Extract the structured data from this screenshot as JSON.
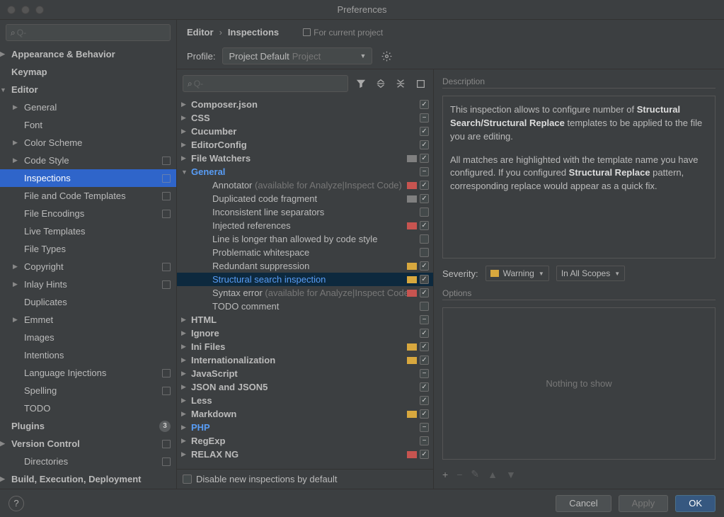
{
  "window": {
    "title": "Preferences"
  },
  "sidebar": {
    "search_placeholder": "Q-",
    "items": [
      {
        "label": "Appearance & Behavior",
        "level": 0,
        "arrow": "▶"
      },
      {
        "label": "Keymap",
        "level": 0
      },
      {
        "label": "Editor",
        "level": 0,
        "arrow": "▼"
      },
      {
        "label": "General",
        "level": 1,
        "arrow": "▶"
      },
      {
        "label": "Font",
        "level": 1
      },
      {
        "label": "Color Scheme",
        "level": 1,
        "arrow": "▶"
      },
      {
        "label": "Code Style",
        "level": 1,
        "arrow": "▶",
        "proj": true
      },
      {
        "label": "Inspections",
        "level": 1,
        "proj": true,
        "selected": true
      },
      {
        "label": "File and Code Templates",
        "level": 1,
        "proj": true
      },
      {
        "label": "File Encodings",
        "level": 1,
        "proj": true
      },
      {
        "label": "Live Templates",
        "level": 1
      },
      {
        "label": "File Types",
        "level": 1
      },
      {
        "label": "Copyright",
        "level": 1,
        "arrow": "▶",
        "proj": true
      },
      {
        "label": "Inlay Hints",
        "level": 1,
        "arrow": "▶",
        "proj": true
      },
      {
        "label": "Duplicates",
        "level": 1
      },
      {
        "label": "Emmet",
        "level": 1,
        "arrow": "▶"
      },
      {
        "label": "Images",
        "level": 1
      },
      {
        "label": "Intentions",
        "level": 1
      },
      {
        "label": "Language Injections",
        "level": 1,
        "proj": true
      },
      {
        "label": "Spelling",
        "level": 1,
        "proj": true
      },
      {
        "label": "TODO",
        "level": 1
      },
      {
        "label": "Plugins",
        "level": 0,
        "badge": "3"
      },
      {
        "label": "Version Control",
        "level": 0,
        "arrow": "▶",
        "proj": true
      },
      {
        "label": "Directories",
        "level": 1,
        "proj": true
      },
      {
        "label": "Build, Execution, Deployment",
        "level": 0,
        "arrow": "▶"
      }
    ]
  },
  "breadcrumb": {
    "a": "Editor",
    "b": "Inspections",
    "for_project": "For current project"
  },
  "profile": {
    "label": "Profile:",
    "name": "Project Default",
    "scope": "Project"
  },
  "insp_search_placeholder": "Q-",
  "inspections": [
    {
      "label": "Composer.json",
      "arrow": "▶",
      "bold": true,
      "chk": "checked"
    },
    {
      "label": "CSS",
      "arrow": "▶",
      "bold": true,
      "chk": "mixed"
    },
    {
      "label": "Cucumber",
      "arrow": "▶",
      "bold": true,
      "chk": "checked"
    },
    {
      "label": "EditorConfig",
      "arrow": "▶",
      "bold": true,
      "chk": "checked"
    },
    {
      "label": "File Watchers",
      "arrow": "▶",
      "bold": true,
      "chk": "checked",
      "sev": "gray"
    },
    {
      "label": "General",
      "arrow": "▼",
      "bold": true,
      "blue": true,
      "chk": "mixed"
    },
    {
      "label": "Annotator",
      "hint": " (available for Analyze|Inspect Code)",
      "child": true,
      "chk": "checked",
      "sev": "red"
    },
    {
      "label": "Duplicated code fragment",
      "child": true,
      "chk": "checked",
      "sev": "gray"
    },
    {
      "label": "Inconsistent line separators",
      "child": true,
      "chk": ""
    },
    {
      "label": "Injected references",
      "child": true,
      "chk": "checked",
      "sev": "red"
    },
    {
      "label": "Line is longer than allowed by code style",
      "child": true,
      "chk": ""
    },
    {
      "label": "Problematic whitespace",
      "child": true,
      "chk": ""
    },
    {
      "label": "Redundant suppression",
      "child": true,
      "chk": "checked",
      "sev": "yellow"
    },
    {
      "label": "Structural search inspection",
      "child": true,
      "chk": "checked",
      "sev": "yellow",
      "selected": true,
      "blue": true
    },
    {
      "label": "Syntax error",
      "hint": " (available for Analyze|Inspect Code)",
      "child": true,
      "chk": "checked",
      "sev": "red"
    },
    {
      "label": "TODO comment",
      "child": true,
      "chk": ""
    },
    {
      "label": "HTML",
      "arrow": "▶",
      "bold": true,
      "chk": "mixed"
    },
    {
      "label": "Ignore",
      "arrow": "▶",
      "bold": true,
      "chk": "checked"
    },
    {
      "label": "Ini Files",
      "arrow": "▶",
      "bold": true,
      "chk": "checked",
      "sev": "yellow"
    },
    {
      "label": "Internationalization",
      "arrow": "▶",
      "bold": true,
      "chk": "checked",
      "sev": "yellow"
    },
    {
      "label": "JavaScript",
      "arrow": "▶",
      "bold": true,
      "chk": "mixed"
    },
    {
      "label": "JSON and JSON5",
      "arrow": "▶",
      "bold": true,
      "chk": "checked"
    },
    {
      "label": "Less",
      "arrow": "▶",
      "bold": true,
      "chk": "checked"
    },
    {
      "label": "Markdown",
      "arrow": "▶",
      "bold": true,
      "chk": "checked",
      "sev": "yellow"
    },
    {
      "label": "PHP",
      "arrow": "▶",
      "bold": true,
      "blue": true,
      "chk": "mixed"
    },
    {
      "label": "RegExp",
      "arrow": "▶",
      "bold": true,
      "chk": "mixed"
    },
    {
      "label": "RELAX NG",
      "arrow": "▶",
      "bold": true,
      "chk": "checked",
      "sev": "red"
    }
  ],
  "disable_new": "Disable new inspections by default",
  "detail": {
    "desc_head": "Description",
    "desc_p1a": "This inspection allows to configure number of ",
    "desc_b1": "Structural Search/Structural Replace",
    "desc_p1b": " templates to be applied to the file you are editing.",
    "desc_p2a": "All matches are highlighted with the template name you have configured. If you configured ",
    "desc_b2": "Structural Replace",
    "desc_p2b": " pattern, corresponding replace would appear as a quick fix.",
    "sev_label": "Severity:",
    "sev_value": "Warning",
    "scope_value": "In All Scopes",
    "opt_head": "Options",
    "opt_empty": "Nothing to show"
  },
  "buttons": {
    "cancel": "Cancel",
    "apply": "Apply",
    "ok": "OK",
    "help": "?"
  }
}
